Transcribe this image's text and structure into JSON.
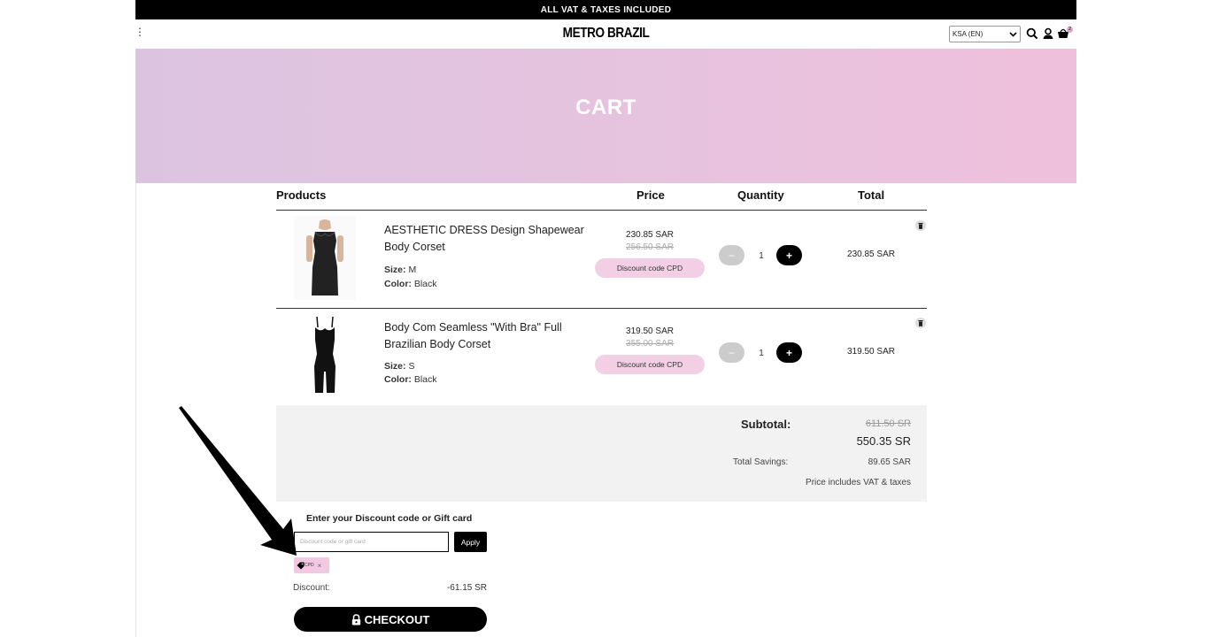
{
  "topbar": {
    "text": "ALL VAT & TAXES INCLUDED"
  },
  "header": {
    "menu_glyph": "⋮",
    "logo": "METRO BRAZIL",
    "country_select": "KSA (EN)",
    "cart_count": "2",
    "icons": [
      "search-icon",
      "user-icon",
      "cart-icon"
    ]
  },
  "hero": {
    "title": "CART"
  },
  "table": {
    "headers": {
      "products": "Products",
      "price": "Price",
      "quantity": "Quantity",
      "total": "Total"
    }
  },
  "items": [
    {
      "name": "AESTHETIC DRESS Design Shapewear Body Corset",
      "size_label": "Size:",
      "size": "M",
      "color_label": "Color:",
      "color": "Black",
      "price_now": "230.85 SAR",
      "price_old": "256.50 SAR",
      "discount_note": "Discount code CPD",
      "qty_minus": "−",
      "qty": "1",
      "qty_plus": "+",
      "total": "230.85 SAR"
    },
    {
      "name": "Body Com Seamless \"With Bra\" Full Brazilian Body Corset",
      "size_label": "Size:",
      "size": "S",
      "color_label": "Color:",
      "color": "Black",
      "price_now": "319.50 SAR",
      "price_old": "355.00 SAR",
      "discount_note": "Discount code CPD",
      "qty_minus": "−",
      "qty": "1",
      "qty_plus": "+",
      "total": "319.50 SAR"
    }
  ],
  "summary": {
    "subtotal_label": "Subtotal:",
    "subtotal_old": "611.50 SR",
    "subtotal_new": "550.35 SR",
    "savings_label": "Total Savings:",
    "savings_value": "89.65 SAR",
    "vat_note": "Price includes VAT & taxes"
  },
  "discount": {
    "title": "Enter your Discount code or Gift card",
    "placeholder": "Discount code or gift card",
    "apply_label": "Apply",
    "applied_code": "CPD",
    "remove_glyph": "×",
    "discount_label": "Discount:",
    "discount_value": "-61.15 SR"
  },
  "checkout": {
    "label": "CHECKOUT"
  },
  "colors": {
    "accent_pink": "#f3cfe6",
    "black": "#000000",
    "hero_start": "#dcc4e1",
    "hero_end": "#efc0dc"
  }
}
